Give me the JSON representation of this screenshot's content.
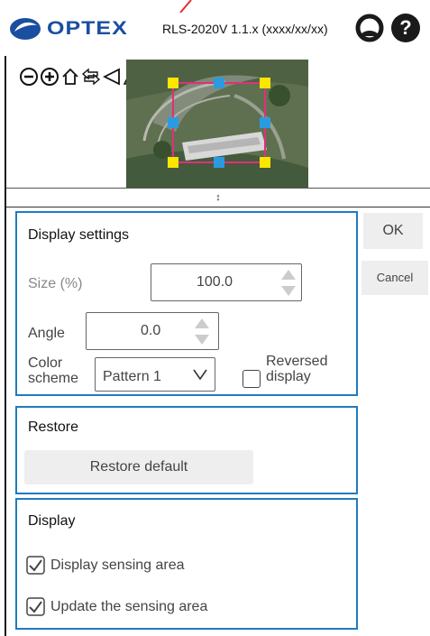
{
  "header": {
    "brand": "OPTEX",
    "version": "RLS-2020V 1.1.x (xxxx/xx/xx)",
    "colors": {
      "brand": "#1a4ea1",
      "accent": "#e03030"
    }
  },
  "toolbar": {
    "icons": [
      "zoom-out-icon",
      "zoom-in-icon",
      "home-icon",
      "pan-arrows-icon",
      "rotate-left-icon",
      "flip-icon"
    ]
  },
  "display_settings": {
    "title": "Display settings",
    "size_label": "Size",
    "size_unit": "(%)",
    "size_value": "100.0",
    "angle_label": "Angle",
    "angle_value": "0.0",
    "color_scheme_label_1": "Color",
    "color_scheme_label_2": "scheme",
    "color_scheme_value": "Pattern 1",
    "reversed_label_1": "Reversed",
    "reversed_label_2": "display",
    "reversed_checked": false
  },
  "actions": {
    "ok_label": "OK",
    "cancel_label": "Cancel"
  },
  "restore": {
    "title": "Restore",
    "button_label": "Restore default"
  },
  "display": {
    "title": "Display",
    "items": [
      {
        "label": "Display sensing area",
        "checked": true
      },
      {
        "label": "Update the sensing area",
        "checked": true
      }
    ]
  },
  "splitter": {
    "glyph": "↕"
  }
}
